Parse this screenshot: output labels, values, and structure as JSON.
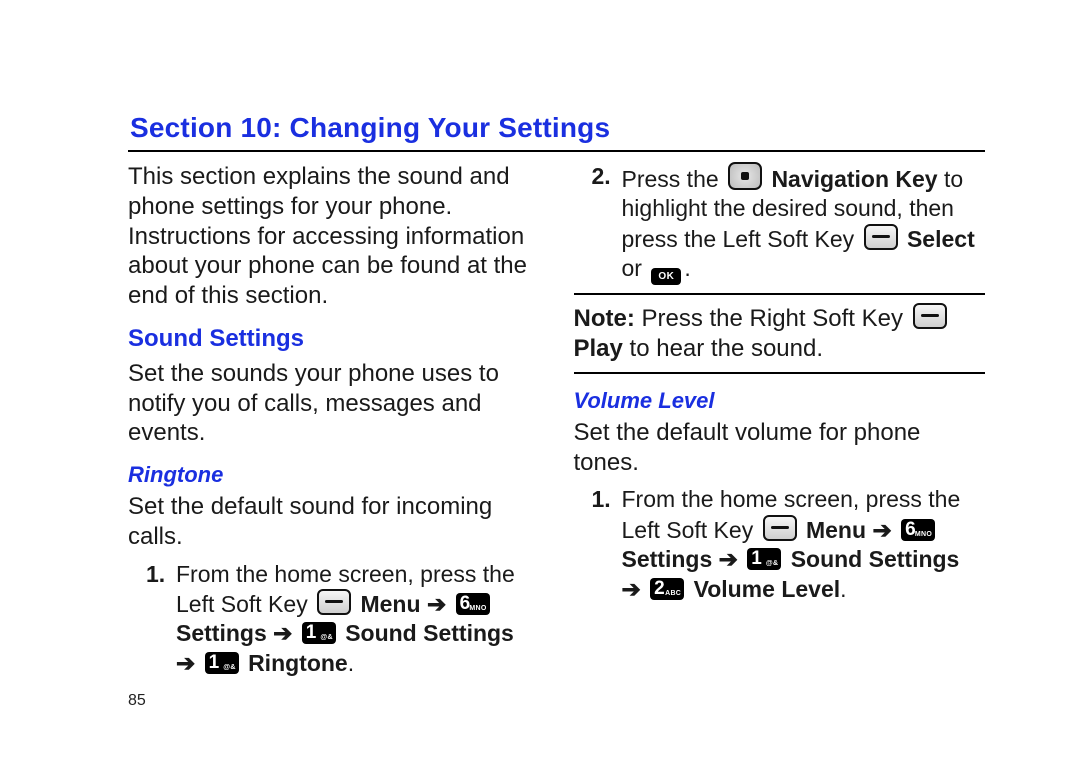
{
  "title": "Section 10: Changing Your Settings",
  "intro": "This section explains the sound and phone settings for your phone. Instructions for accessing information about your phone can be found at the end of this section.",
  "soundSettings": {
    "heading": "Sound Settings",
    "desc": "Set the sounds your phone uses to notify you of calls, messages and events."
  },
  "ringtone": {
    "heading": "Ringtone",
    "desc": "Set the default sound for incoming calls.",
    "step1": {
      "num": "1.",
      "t1": "From the home screen, press the Left Soft Key ",
      "menu": "Menu",
      "arrow": " ➔ ",
      "settings": "Settings",
      "sound": "Sound Settings",
      "ringtone": "Ringtone",
      "dot": "."
    }
  },
  "step2": {
    "num": "2.",
    "t1": "Press the ",
    "navkey": "Navigation Key",
    "t2": " to highlight the desired sound, then press the Left Soft Key ",
    "select": "Select",
    "or": " or ",
    "dot": "."
  },
  "note": {
    "label": "Note:",
    "t1": " Press the Right Soft Key ",
    "play": "Play",
    "t2": " to hear the sound."
  },
  "volume": {
    "heading": "Volume Level",
    "desc": "Set the default volume for phone tones.",
    "step1": {
      "num": "1.",
      "t1": "From the home screen, press the Left Soft Key ",
      "menu": "Menu",
      "arrow": " ➔ ",
      "settings": "Settings",
      "sound": "Sound Settings",
      "vl": "Volume Level",
      "dot": "."
    }
  },
  "keys": {
    "six": {
      "big": "6",
      "sub": "MNO"
    },
    "one": {
      "big": "1",
      "sub": "@&"
    },
    "two": {
      "big": "2",
      "sub": "ABC"
    },
    "ok": "OK"
  },
  "pageNumber": "85"
}
